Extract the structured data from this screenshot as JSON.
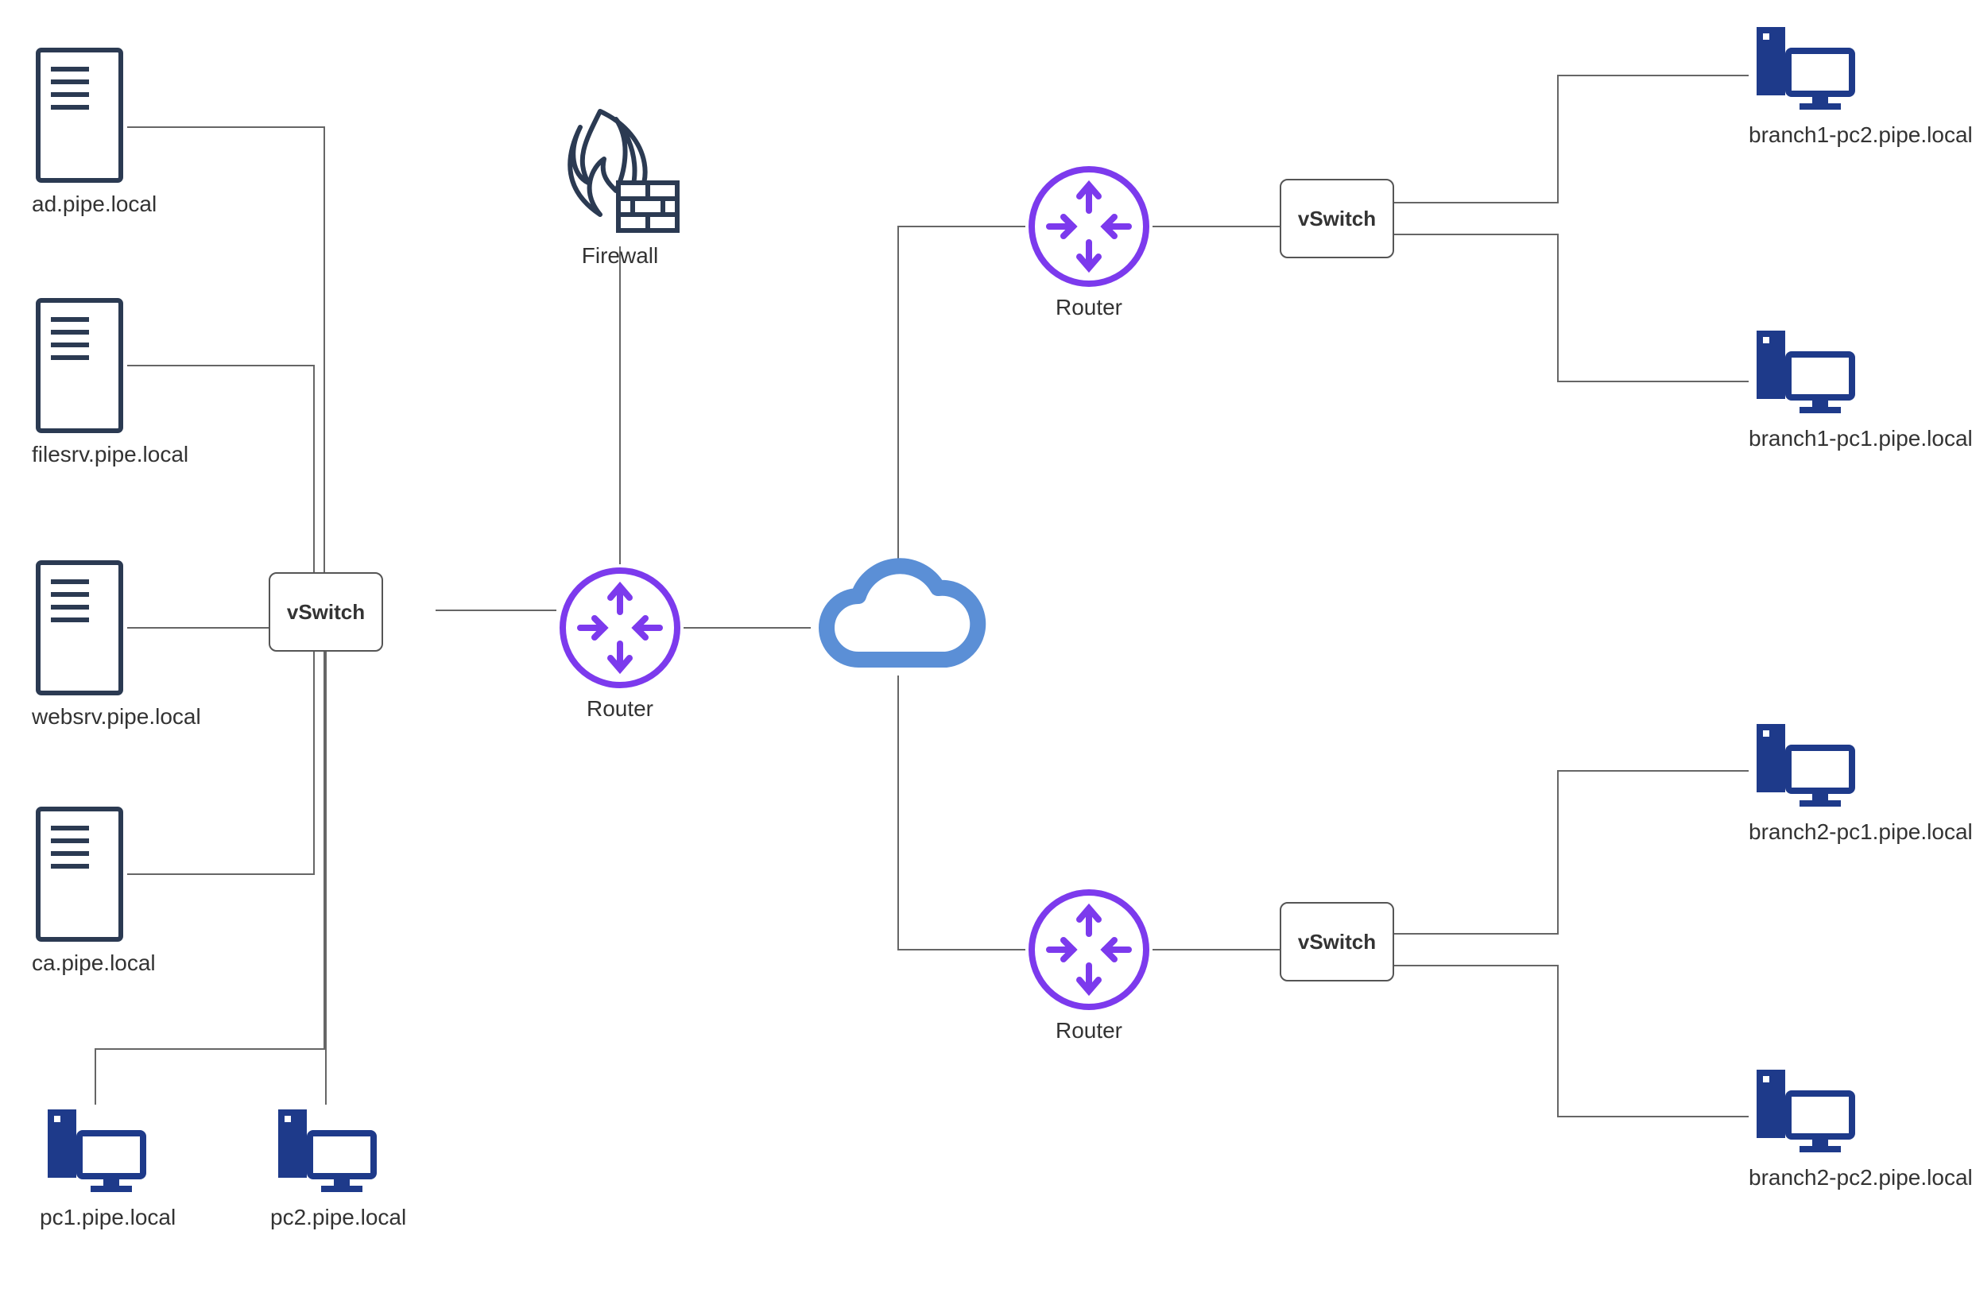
{
  "nodes": {
    "ad": {
      "label": "ad.pipe.local"
    },
    "filesrv": {
      "label": "filesrv.pipe.local"
    },
    "websrv": {
      "label": "websrv.pipe.local"
    },
    "ca": {
      "label": "ca.pipe.local"
    },
    "pc1": {
      "label": "pc1.pipe.local"
    },
    "pc2": {
      "label": "pc2.pipe.local"
    },
    "branch1pc1": {
      "label": "branch1-pc1.pipe.local"
    },
    "branch1pc2": {
      "label": "branch1-pc2.pipe.local"
    },
    "branch2pc1": {
      "label": "branch2-pc1.pipe.local"
    },
    "branch2pc2": {
      "label": "branch2-pc2.pipe.local"
    },
    "firewall": {
      "label": "Firewall"
    },
    "router_main": {
      "label": "Router"
    },
    "router_branch1": {
      "label": "Router"
    },
    "router_branch2": {
      "label": "Router"
    },
    "vswitch_main": {
      "label": "vSwitch"
    },
    "vswitch_branch1": {
      "label": "vSwitch"
    },
    "vswitch_branch2": {
      "label": "vSwitch"
    },
    "cloud": {
      "label": ""
    }
  },
  "colors": {
    "server_stroke": "#2b3a52",
    "pc_fill": "#1e3a8a",
    "router_stroke": "#7c3aed",
    "cloud_stroke": "#5b8fd6",
    "firewall_stroke": "#2b3a52",
    "wire": "#666"
  },
  "connections": [
    [
      "ad",
      "vswitch_main"
    ],
    [
      "filesrv",
      "vswitch_main"
    ],
    [
      "websrv",
      "vswitch_main"
    ],
    [
      "ca",
      "vswitch_main"
    ],
    [
      "pc1",
      "vswitch_main"
    ],
    [
      "pc2",
      "vswitch_main"
    ],
    [
      "vswitch_main",
      "router_main"
    ],
    [
      "firewall",
      "router_main"
    ],
    [
      "router_main",
      "cloud"
    ],
    [
      "cloud",
      "router_branch1"
    ],
    [
      "cloud",
      "router_branch2"
    ],
    [
      "router_branch1",
      "vswitch_branch1"
    ],
    [
      "router_branch2",
      "vswitch_branch2"
    ],
    [
      "vswitch_branch1",
      "branch1pc1"
    ],
    [
      "vswitch_branch1",
      "branch1pc2"
    ],
    [
      "vswitch_branch2",
      "branch2pc1"
    ],
    [
      "vswitch_branch2",
      "branch2pc2"
    ]
  ]
}
